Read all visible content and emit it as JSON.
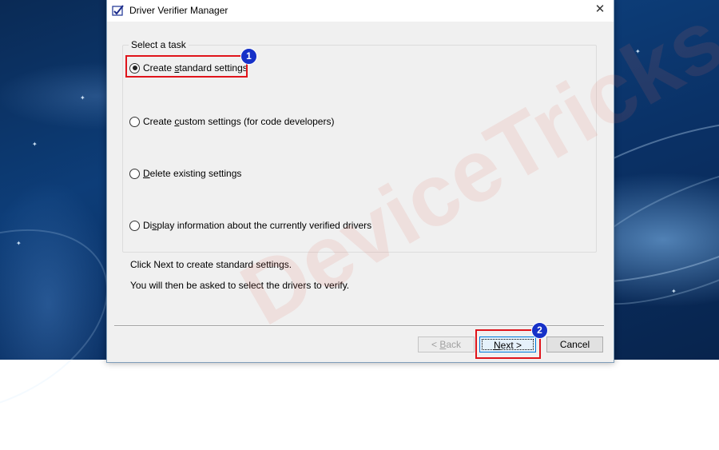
{
  "window": {
    "title": "Driver Verifier Manager",
    "close_glyph": "✕"
  },
  "task_group": {
    "label": "Select a task",
    "options": [
      {
        "pre": "Create ",
        "key": "s",
        "post": "tandard settings",
        "checked": true
      },
      {
        "pre": "Create ",
        "key": "c",
        "post": "ustom settings (for code developers)",
        "checked": false
      },
      {
        "pre": "",
        "key": "D",
        "post": "elete existing settings",
        "checked": false
      },
      {
        "pre": "Di",
        "key": "s",
        "post": "play information about the currently verified drivers",
        "checked": false
      }
    ]
  },
  "description": {
    "line1": "Click Next to create standard settings.",
    "line2": "You will then be asked to select the drivers to verify."
  },
  "buttons": {
    "back": {
      "pre": "< ",
      "key": "B",
      "post": "ack"
    },
    "next": {
      "pre": "",
      "key": "N",
      "post": "ext >"
    },
    "cancel": "Cancel"
  },
  "annotations": {
    "step1": "1",
    "step2": "2"
  },
  "watermark": "DeviceTricks",
  "colors": {
    "highlight": "#e0141b",
    "badge": "#1631c8"
  }
}
